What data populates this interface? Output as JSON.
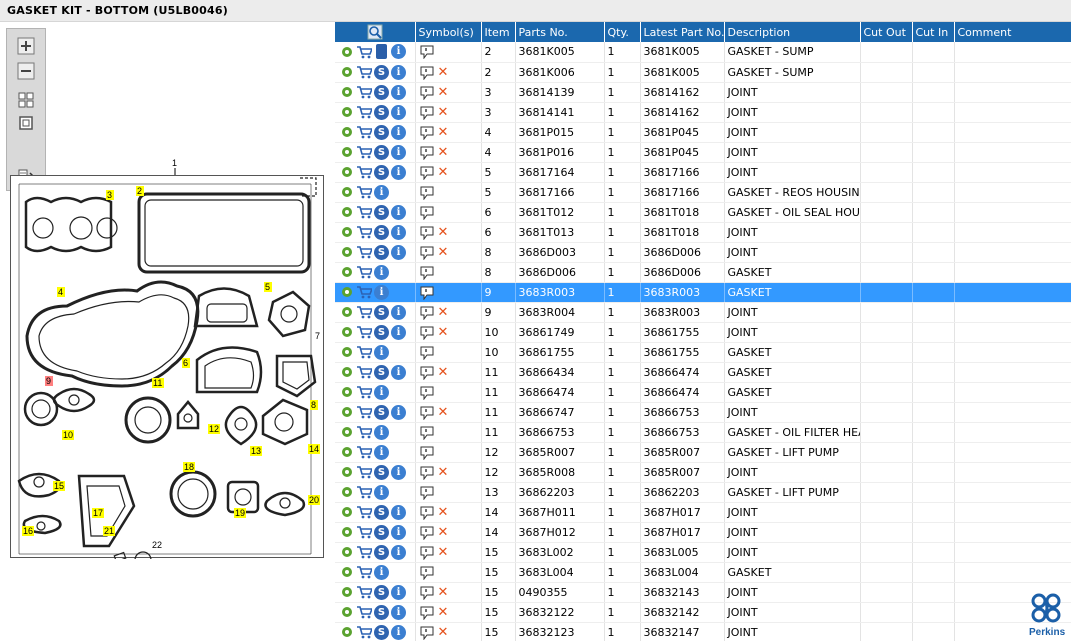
{
  "title": "GASKET KIT - BOTTOM (U5LB0046)",
  "toolbar": {
    "zoom_in_icon": "plus-icon",
    "zoom_out_icon": "minus-icon",
    "fit_icon": "fit-icon",
    "actual_icon": "square-icon",
    "export_icon": "export-icon"
  },
  "diagram": {
    "callouts": [
      "1",
      "2",
      "3",
      "4",
      "5",
      "6",
      "7",
      "8",
      "9",
      "10",
      "11",
      "12",
      "13",
      "14",
      "15",
      "16",
      "17",
      "18",
      "19",
      "20",
      "21",
      "22"
    ]
  },
  "grid": {
    "columns": [
      "",
      "Symbol(s)",
      "Item",
      "Parts No.",
      "Qty.",
      "Latest Part No.",
      "Description",
      "Cut Out",
      "Cut In",
      "Comment"
    ],
    "rows": [
      {
        "item": "2",
        "part": "3681K005",
        "qty": "1",
        "latest": "3681K005",
        "desc": "GASKET - SUMP",
        "s": false,
        "book": true,
        "x": false
      },
      {
        "item": "2",
        "part": "3681K006",
        "qty": "1",
        "latest": "3681K005",
        "desc": "GASKET - SUMP",
        "s": true,
        "book": false,
        "x": true
      },
      {
        "item": "3",
        "part": "36814139",
        "qty": "1",
        "latest": "36814162",
        "desc": "JOINT",
        "s": true,
        "book": false,
        "x": true
      },
      {
        "item": "3",
        "part": "36814141",
        "qty": "1",
        "latest": "36814162",
        "desc": "JOINT",
        "s": true,
        "book": false,
        "x": true
      },
      {
        "item": "4",
        "part": "3681P015",
        "qty": "1",
        "latest": "3681P045",
        "desc": "JOINT",
        "s": true,
        "book": false,
        "x": true
      },
      {
        "item": "4",
        "part": "3681P016",
        "qty": "1",
        "latest": "3681P045",
        "desc": "JOINT",
        "s": true,
        "book": false,
        "x": true
      },
      {
        "item": "5",
        "part": "36817164",
        "qty": "1",
        "latest": "36817166",
        "desc": "JOINT",
        "s": true,
        "book": false,
        "x": true
      },
      {
        "item": "5",
        "part": "36817166",
        "qty": "1",
        "latest": "36817166",
        "desc": "GASKET - REOS HOUSING",
        "s": false,
        "book": false,
        "x": false
      },
      {
        "item": "6",
        "part": "3681T012",
        "qty": "1",
        "latest": "3681T018",
        "desc": "GASKET - OIL SEAL HOUSIN",
        "s": true,
        "book": false,
        "x": false
      },
      {
        "item": "6",
        "part": "3681T013",
        "qty": "1",
        "latest": "3681T018",
        "desc": "JOINT",
        "s": true,
        "book": false,
        "x": true
      },
      {
        "item": "8",
        "part": "3686D003",
        "qty": "1",
        "latest": "3686D006",
        "desc": "JOINT",
        "s": true,
        "book": false,
        "x": true
      },
      {
        "item": "8",
        "part": "3686D006",
        "qty": "1",
        "latest": "3686D006",
        "desc": "GASKET",
        "s": false,
        "book": false,
        "x": false
      },
      {
        "item": "9",
        "part": "3683R003",
        "qty": "1",
        "latest": "3683R003",
        "desc": "GASKET",
        "s": false,
        "book": false,
        "x": false,
        "selected": true
      },
      {
        "item": "9",
        "part": "3683R004",
        "qty": "1",
        "latest": "3683R003",
        "desc": "JOINT",
        "s": true,
        "book": false,
        "x": true
      },
      {
        "item": "10",
        "part": "36861749",
        "qty": "1",
        "latest": "36861755",
        "desc": "JOINT",
        "s": true,
        "book": false,
        "x": true
      },
      {
        "item": "10",
        "part": "36861755",
        "qty": "1",
        "latest": "36861755",
        "desc": "GASKET",
        "s": false,
        "book": false,
        "x": false
      },
      {
        "item": "11",
        "part": "36866434",
        "qty": "1",
        "latest": "36866474",
        "desc": "GASKET",
        "s": true,
        "book": false,
        "x": true
      },
      {
        "item": "11",
        "part": "36866474",
        "qty": "1",
        "latest": "36866474",
        "desc": "GASKET",
        "s": false,
        "book": false,
        "x": false
      },
      {
        "item": "11",
        "part": "36866747",
        "qty": "1",
        "latest": "36866753",
        "desc": "JOINT",
        "s": true,
        "book": false,
        "x": true
      },
      {
        "item": "11",
        "part": "36866753",
        "qty": "1",
        "latest": "36866753",
        "desc": "GASKET - OIL FILTER HEAD",
        "s": false,
        "book": false,
        "x": false
      },
      {
        "item": "12",
        "part": "3685R007",
        "qty": "1",
        "latest": "3685R007",
        "desc": "GASKET - LIFT PUMP",
        "s": false,
        "book": false,
        "x": false
      },
      {
        "item": "12",
        "part": "3685R008",
        "qty": "1",
        "latest": "3685R007",
        "desc": "JOINT",
        "s": true,
        "book": false,
        "x": true
      },
      {
        "item": "13",
        "part": "36862203",
        "qty": "1",
        "latest": "36862203",
        "desc": "GASKET - LIFT PUMP",
        "s": false,
        "book": false,
        "x": false
      },
      {
        "item": "14",
        "part": "3687H011",
        "qty": "1",
        "latest": "3687H017",
        "desc": "JOINT",
        "s": true,
        "book": false,
        "x": true
      },
      {
        "item": "14",
        "part": "3687H012",
        "qty": "1",
        "latest": "3687H017",
        "desc": "JOINT",
        "s": true,
        "book": false,
        "x": true
      },
      {
        "item": "15",
        "part": "3683L002",
        "qty": "1",
        "latest": "3683L005",
        "desc": "JOINT",
        "s": true,
        "book": false,
        "x": true
      },
      {
        "item": "15",
        "part": "3683L004",
        "qty": "1",
        "latest": "3683L004",
        "desc": "GASKET",
        "s": false,
        "book": false,
        "x": false
      },
      {
        "item": "15",
        "part": "0490355",
        "qty": "1",
        "latest": "36832143",
        "desc": "JOINT",
        "s": true,
        "book": false,
        "x": true
      },
      {
        "item": "15",
        "part": "36832122",
        "qty": "1",
        "latest": "36832142",
        "desc": "JOINT",
        "s": true,
        "book": false,
        "x": true
      },
      {
        "item": "15",
        "part": "36832123",
        "qty": "1",
        "latest": "36832147",
        "desc": "JOINT",
        "s": true,
        "book": false,
        "x": true
      }
    ]
  },
  "brand": {
    "name": "Perkins",
    "color": "#1b5fa8"
  },
  "colors": {
    "header": "#1b68ae",
    "selected": "#3399ff",
    "delete": "#e5511b"
  }
}
